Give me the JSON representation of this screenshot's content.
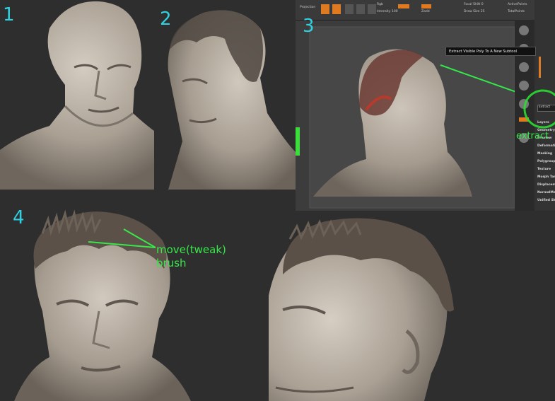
{
  "steps": {
    "s1": "1",
    "s2": "2",
    "s3": "3",
    "s4": "4"
  },
  "annotations": {
    "extract": "extract",
    "brush_line1": "move(tweak)",
    "brush_line2": "brush"
  },
  "zbrush": {
    "tooltip": "Extract Visible Poly To A New Subtool",
    "menu_items": [
      "Layers",
      "Geometry",
      "Preview",
      "Deformation",
      "Masking",
      "Polygroups",
      "Texture",
      "Morph Target",
      "Displacement",
      "NormalMap",
      "Unified Skin"
    ],
    "extract_label": "Extract",
    "toolbar": [
      "Projection",
      "Master",
      "Zadd",
      "Zsub",
      "Zcut",
      "Rgb",
      "Intensity 100",
      "Draw Size 25",
      "Focal Shift 0",
      "ActivePoints",
      "TotalPoints"
    ]
  },
  "colors": {
    "step_color": "#2fd0e0",
    "annotation_color": "#37e84a",
    "highlight_ring": "#2bdc34",
    "clay": "#b9b0a5"
  }
}
